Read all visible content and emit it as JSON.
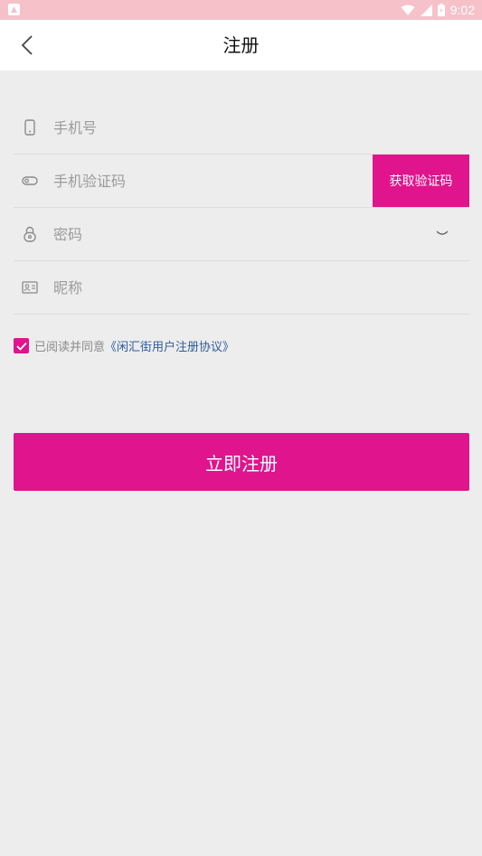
{
  "status_bar": {
    "time": "9:02"
  },
  "header": {
    "title": "注册"
  },
  "form": {
    "phone": {
      "placeholder": "手机号",
      "icon": "phone-icon"
    },
    "sms_code": {
      "placeholder": "手机验证码",
      "icon": "key-icon",
      "button_label": "获取验证码"
    },
    "password": {
      "placeholder": "密码",
      "icon": "lock-icon",
      "toggle_icon": "eye-closed-icon"
    },
    "nickname": {
      "placeholder": "昵称",
      "icon": "id-card-icon"
    }
  },
  "agreement": {
    "checked": true,
    "text": "已阅读并同意",
    "link_text": "《闲汇街用户注册协议》"
  },
  "submit": {
    "label": "立即注册"
  },
  "colors": {
    "accent": "#e0148c",
    "status_bar": "#f6c1c9",
    "background": "#ededed",
    "link": "#2e5c99"
  }
}
